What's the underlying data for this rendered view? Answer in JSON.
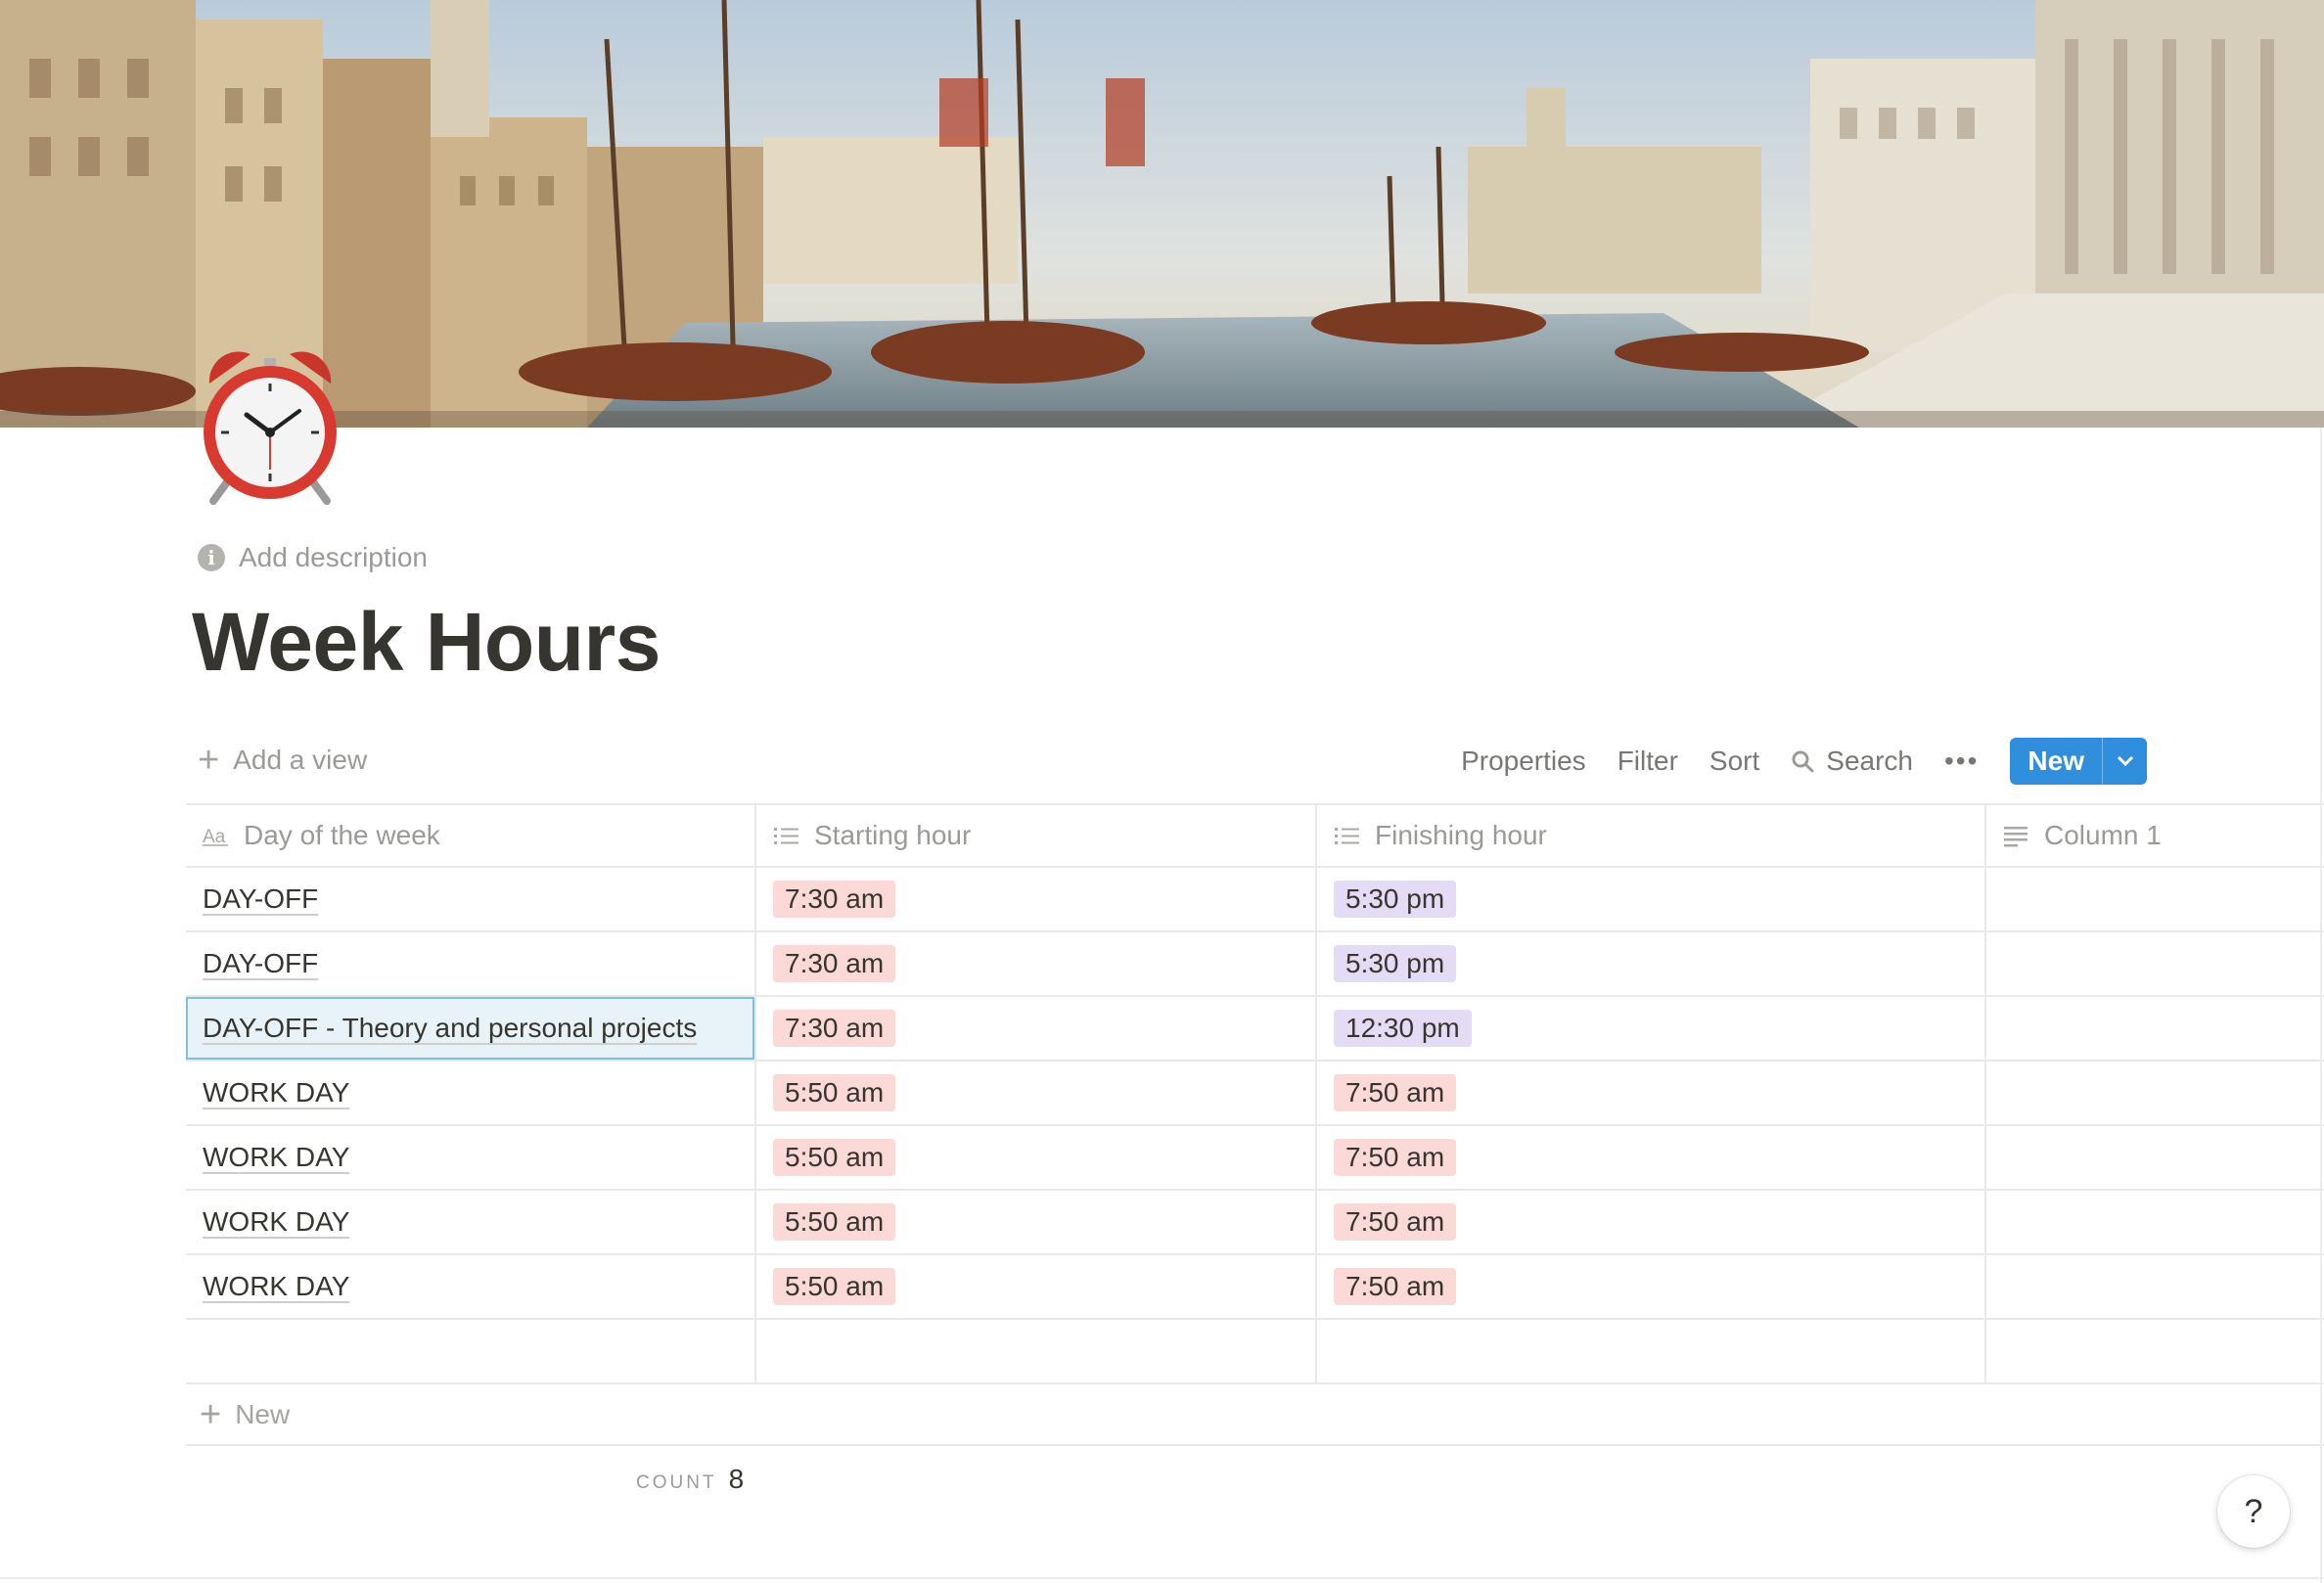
{
  "page": {
    "title": "Week Hours",
    "description_placeholder": "Add description",
    "icon": "alarm-clock-icon"
  },
  "toolbar": {
    "add_view": "Add a view",
    "properties": "Properties",
    "filter": "Filter",
    "sort": "Sort",
    "search": "Search",
    "new": "New"
  },
  "table": {
    "columns": [
      "Day of the week",
      "Starting hour",
      "Finishing hour",
      "Column 1"
    ],
    "rows": [
      {
        "day": "DAY-OFF",
        "start": "7:30 am",
        "finish": "5:30 pm"
      },
      {
        "day": "DAY-OFF",
        "start": "7:30 am",
        "finish": "5:30 pm"
      },
      {
        "day": "DAY-OFF - Theory and personal projects",
        "start": "7:30 am",
        "finish": "12:30 pm"
      },
      {
        "day": "WORK DAY",
        "start": "5:50 am",
        "finish": "7:50 am"
      },
      {
        "day": "WORK DAY",
        "start": "5:50 am",
        "finish": "7:50 am"
      },
      {
        "day": "WORK DAY",
        "start": "5:50 am",
        "finish": "7:50 am"
      },
      {
        "day": "WORK DAY",
        "start": "5:50 am",
        "finish": "7:50 am"
      }
    ],
    "new_row": "New",
    "count_label": "COUNT",
    "count_value": "8"
  },
  "help": "?",
  "colors": {
    "tag_red": "#fbd9d6",
    "tag_purple": "#e4dcf5",
    "accent_blue": "#2f8fdd",
    "selection": "#e7f3f8"
  }
}
